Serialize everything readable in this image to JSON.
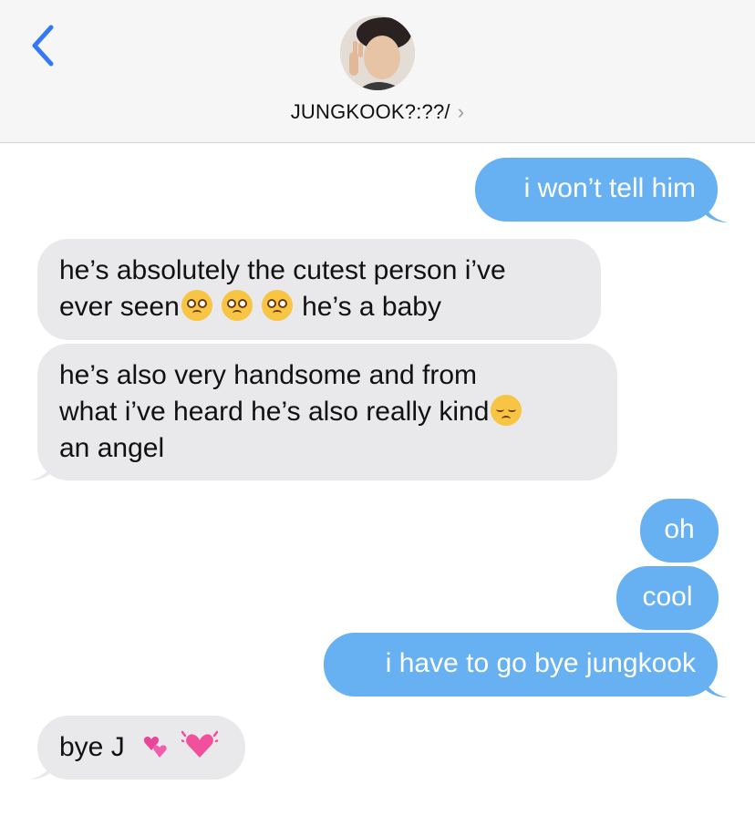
{
  "header": {
    "contact_name": "JUNGKOOK?:??/",
    "chevron": "›",
    "back_icon": "chevron-left-icon",
    "accent_color": "#3478f6"
  },
  "messages": [
    {
      "from": "me",
      "text": "i won’t tell him"
    },
    {
      "from": "them",
      "line1a": "he’s absolutely the cutest person i’ve",
      "line2a": "ever seen",
      "line2b": " he’s a baby",
      "emojis": [
        "pleading-face-emoji",
        "pleading-face-emoji",
        "pleading-face-emoji"
      ]
    },
    {
      "from": "them",
      "line1": "he’s also very handsome and from",
      "line2": "what i’ve heard he’s also really kind",
      "line3": "an angel",
      "emojis": [
        "disappointed-face-emoji"
      ]
    },
    {
      "from": "me",
      "text": "oh"
    },
    {
      "from": "me",
      "text": "cool"
    },
    {
      "from": "me",
      "text": "i have to go bye jungkook"
    },
    {
      "from": "them",
      "text": "bye J",
      "emojis": [
        "revolving-hearts-emoji",
        "beating-heart-emoji"
      ]
    }
  ],
  "colors": {
    "sent_bubble": "#67b1f3",
    "received_bubble": "#e9e9eb"
  }
}
